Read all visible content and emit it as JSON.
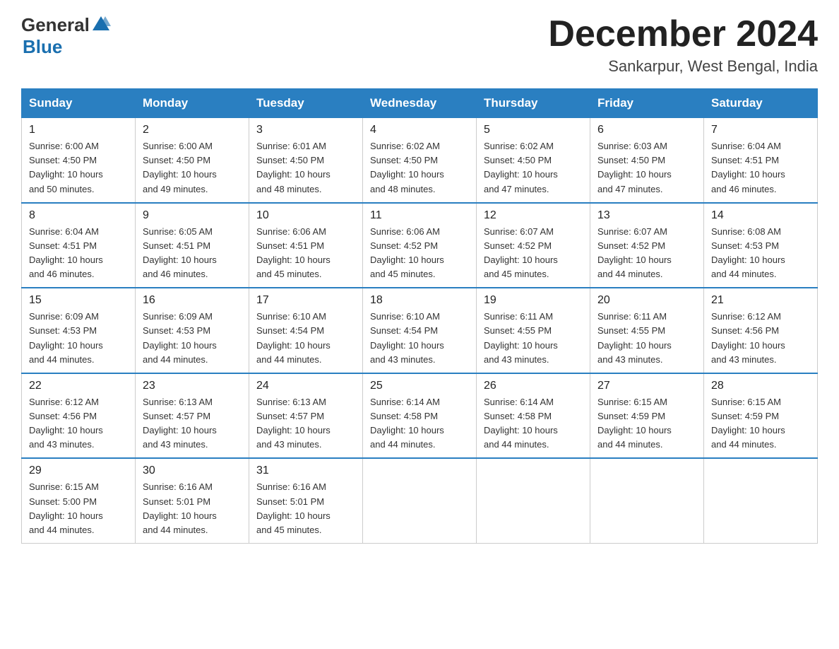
{
  "header": {
    "logo_general": "General",
    "logo_blue": "Blue",
    "month_title": "December 2024",
    "location": "Sankarpur, West Bengal, India"
  },
  "days_of_week": [
    "Sunday",
    "Monday",
    "Tuesday",
    "Wednesday",
    "Thursday",
    "Friday",
    "Saturday"
  ],
  "weeks": [
    [
      {
        "date": "1",
        "sunrise": "6:00 AM",
        "sunset": "4:50 PM",
        "daylight": "10 hours and 50 minutes."
      },
      {
        "date": "2",
        "sunrise": "6:00 AM",
        "sunset": "4:50 PM",
        "daylight": "10 hours and 49 minutes."
      },
      {
        "date": "3",
        "sunrise": "6:01 AM",
        "sunset": "4:50 PM",
        "daylight": "10 hours and 48 minutes."
      },
      {
        "date": "4",
        "sunrise": "6:02 AM",
        "sunset": "4:50 PM",
        "daylight": "10 hours and 48 minutes."
      },
      {
        "date": "5",
        "sunrise": "6:02 AM",
        "sunset": "4:50 PM",
        "daylight": "10 hours and 47 minutes."
      },
      {
        "date": "6",
        "sunrise": "6:03 AM",
        "sunset": "4:50 PM",
        "daylight": "10 hours and 47 minutes."
      },
      {
        "date": "7",
        "sunrise": "6:04 AM",
        "sunset": "4:51 PM",
        "daylight": "10 hours and 46 minutes."
      }
    ],
    [
      {
        "date": "8",
        "sunrise": "6:04 AM",
        "sunset": "4:51 PM",
        "daylight": "10 hours and 46 minutes."
      },
      {
        "date": "9",
        "sunrise": "6:05 AM",
        "sunset": "4:51 PM",
        "daylight": "10 hours and 46 minutes."
      },
      {
        "date": "10",
        "sunrise": "6:06 AM",
        "sunset": "4:51 PM",
        "daylight": "10 hours and 45 minutes."
      },
      {
        "date": "11",
        "sunrise": "6:06 AM",
        "sunset": "4:52 PM",
        "daylight": "10 hours and 45 minutes."
      },
      {
        "date": "12",
        "sunrise": "6:07 AM",
        "sunset": "4:52 PM",
        "daylight": "10 hours and 45 minutes."
      },
      {
        "date": "13",
        "sunrise": "6:07 AM",
        "sunset": "4:52 PM",
        "daylight": "10 hours and 44 minutes."
      },
      {
        "date": "14",
        "sunrise": "6:08 AM",
        "sunset": "4:53 PM",
        "daylight": "10 hours and 44 minutes."
      }
    ],
    [
      {
        "date": "15",
        "sunrise": "6:09 AM",
        "sunset": "4:53 PM",
        "daylight": "10 hours and 44 minutes."
      },
      {
        "date": "16",
        "sunrise": "6:09 AM",
        "sunset": "4:53 PM",
        "daylight": "10 hours and 44 minutes."
      },
      {
        "date": "17",
        "sunrise": "6:10 AM",
        "sunset": "4:54 PM",
        "daylight": "10 hours and 44 minutes."
      },
      {
        "date": "18",
        "sunrise": "6:10 AM",
        "sunset": "4:54 PM",
        "daylight": "10 hours and 43 minutes."
      },
      {
        "date": "19",
        "sunrise": "6:11 AM",
        "sunset": "4:55 PM",
        "daylight": "10 hours and 43 minutes."
      },
      {
        "date": "20",
        "sunrise": "6:11 AM",
        "sunset": "4:55 PM",
        "daylight": "10 hours and 43 minutes."
      },
      {
        "date": "21",
        "sunrise": "6:12 AM",
        "sunset": "4:56 PM",
        "daylight": "10 hours and 43 minutes."
      }
    ],
    [
      {
        "date": "22",
        "sunrise": "6:12 AM",
        "sunset": "4:56 PM",
        "daylight": "10 hours and 43 minutes."
      },
      {
        "date": "23",
        "sunrise": "6:13 AM",
        "sunset": "4:57 PM",
        "daylight": "10 hours and 43 minutes."
      },
      {
        "date": "24",
        "sunrise": "6:13 AM",
        "sunset": "4:57 PM",
        "daylight": "10 hours and 43 minutes."
      },
      {
        "date": "25",
        "sunrise": "6:14 AM",
        "sunset": "4:58 PM",
        "daylight": "10 hours and 44 minutes."
      },
      {
        "date": "26",
        "sunrise": "6:14 AM",
        "sunset": "4:58 PM",
        "daylight": "10 hours and 44 minutes."
      },
      {
        "date": "27",
        "sunrise": "6:15 AM",
        "sunset": "4:59 PM",
        "daylight": "10 hours and 44 minutes."
      },
      {
        "date": "28",
        "sunrise": "6:15 AM",
        "sunset": "4:59 PM",
        "daylight": "10 hours and 44 minutes."
      }
    ],
    [
      {
        "date": "29",
        "sunrise": "6:15 AM",
        "sunset": "5:00 PM",
        "daylight": "10 hours and 44 minutes."
      },
      {
        "date": "30",
        "sunrise": "6:16 AM",
        "sunset": "5:01 PM",
        "daylight": "10 hours and 44 minutes."
      },
      {
        "date": "31",
        "sunrise": "6:16 AM",
        "sunset": "5:01 PM",
        "daylight": "10 hours and 45 minutes."
      },
      null,
      null,
      null,
      null
    ]
  ],
  "labels": {
    "sunrise": "Sunrise:",
    "sunset": "Sunset:",
    "daylight": "Daylight:"
  }
}
